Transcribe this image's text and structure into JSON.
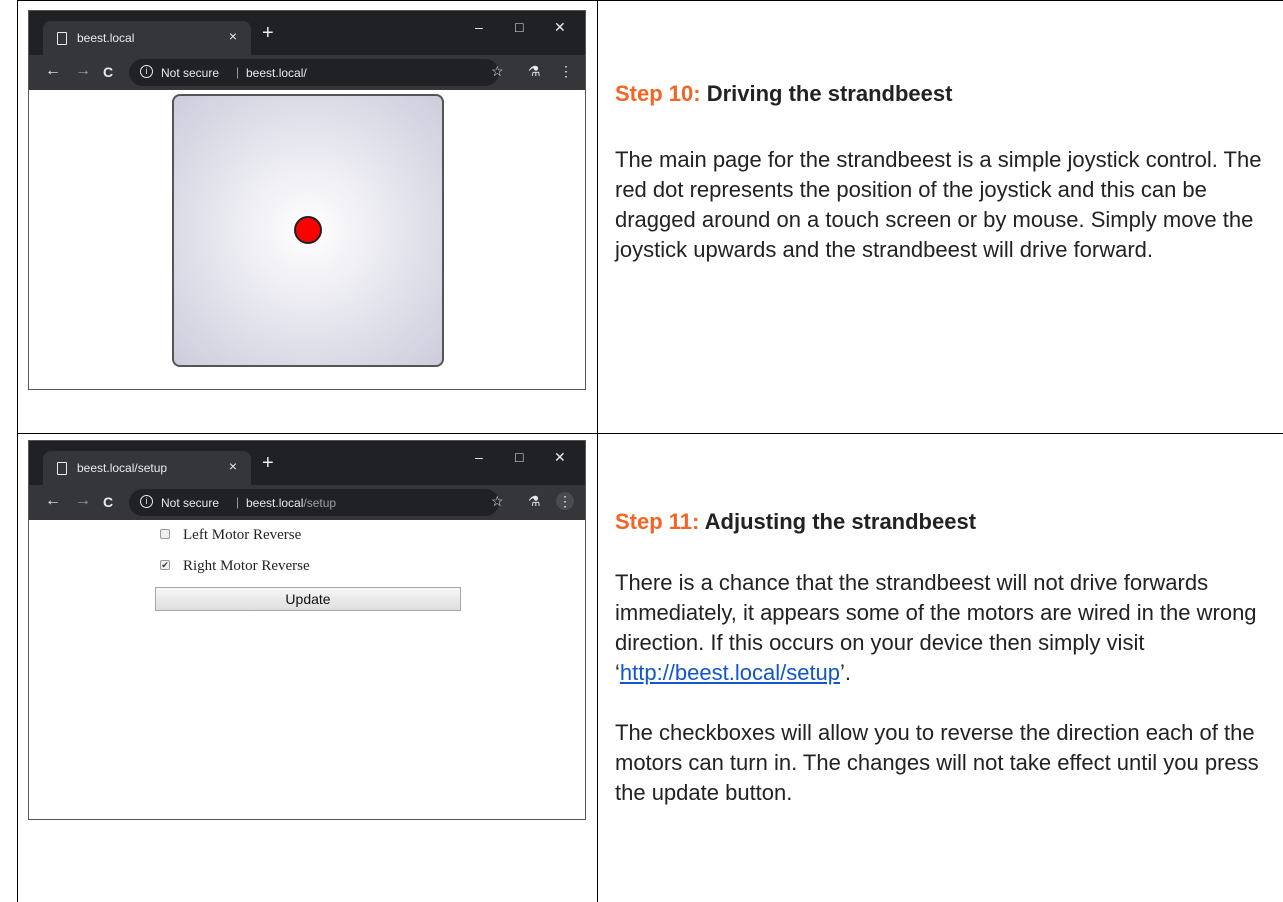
{
  "step10": {
    "heading_number": "Step 10:",
    "heading_title": " Driving the strandbeest",
    "body": "The main page for the strandbeest is a simple joystick control. The red dot represents the position of the joystick and this can be dragged around on a touch screen or by mouse. Simply move the joystick upwards and the strandbeest will drive forward.",
    "browser": {
      "tab_title": "beest.local",
      "not_secure": "Not secure",
      "url_host": "beest.local/",
      "url_path": ""
    }
  },
  "step11": {
    "heading_number": "Step 11:",
    "heading_title": " Adjusting the strandbeest",
    "para1_before": "There is a chance that the strandbeest will not drive forwards immediately, it appears some of the motors are wired in the wrong direction. If this occurs on your device then simply visit ‘",
    "link_text": "http://beest.local/setup",
    "para1_after": "’.",
    "para2": "The checkboxes will allow you to reverse the direction each of the motors can turn in. The changes will not take effect until you press the update button.",
    "browser": {
      "tab_title": "beest.local/setup",
      "not_secure": "Not secure",
      "url_host": "beest.local",
      "url_path": "/setup"
    },
    "setup": {
      "left_motor_label": "Left Motor Reverse",
      "left_motor_checked": false,
      "right_motor_label": "Right Motor Reverse",
      "right_motor_checked": true,
      "update_label": "Update"
    }
  },
  "icons": {
    "page": "page-icon",
    "close": "×",
    "new_tab": "+",
    "minimize": "–",
    "maximize": "□",
    "window_close": "✕",
    "back": "←",
    "forward": "→",
    "reload": "C",
    "info": "i",
    "star": "☆",
    "incognito": "⚗",
    "menu": "⋮",
    "checkmark": "✔"
  },
  "colors": {
    "step_number": "#f26522",
    "link": "#1155cc",
    "joystick_dot": "#ff0000"
  }
}
